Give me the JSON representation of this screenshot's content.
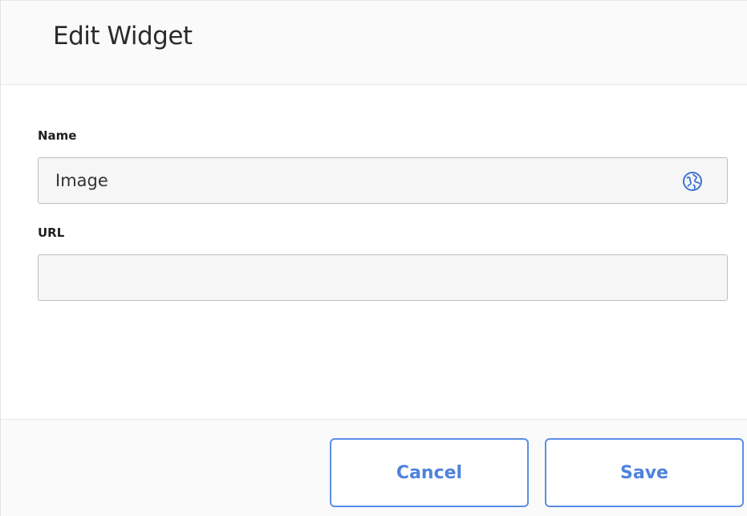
{
  "dialog": {
    "title": "Edit Widget"
  },
  "form": {
    "name_label": "Name",
    "name_value": "Image",
    "url_label": "URL",
    "url_value": ""
  },
  "footer": {
    "cancel_label": "Cancel",
    "save_label": "Save"
  },
  "icons": {
    "name_field_icon": "globe-icon"
  },
  "colors": {
    "accent": "#4f82dc",
    "header_bg": "#fafafa",
    "input_bg": "#f6f6f6",
    "input_border": "#bdbdbd"
  }
}
